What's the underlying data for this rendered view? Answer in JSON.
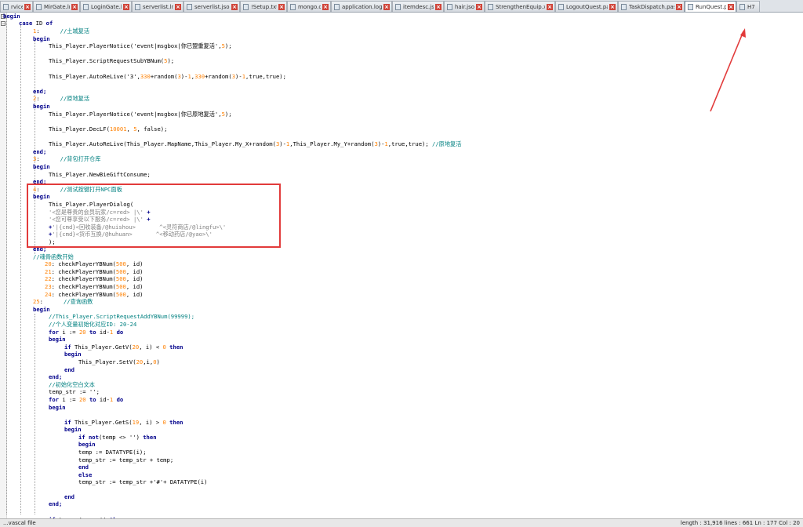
{
  "tabs": [
    {
      "label": "rvice.lni",
      "close": "×",
      "w": 42
    },
    {
      "label": "MirGate.lni",
      "close": "×",
      "w": 60
    },
    {
      "label": "LoginGate.lni",
      "close": "×",
      "w": 66
    },
    {
      "label": "serverlist.lni",
      "close": "×",
      "w": 66
    },
    {
      "label": "serverlist.json",
      "close": "×",
      "w": 72
    },
    {
      "label": "!Setup.txt",
      "close": "×",
      "w": 60
    },
    {
      "label": "mongo.cfg",
      "close": "×",
      "w": 56
    },
    {
      "label": "application.log",
      "close": "×",
      "w": 78
    },
    {
      "label": "itemdesc.json",
      "close": "×",
      "w": 66
    },
    {
      "label": "hair.json",
      "close": "×",
      "w": 52
    },
    {
      "label": "StrengthenEquip.xml",
      "close": "×",
      "w": 90
    },
    {
      "label": "LogoutQuest.pas",
      "close": "×",
      "w": 80
    },
    {
      "label": "TaskDispatch.pas",
      "close": "×",
      "w": 85
    },
    {
      "label": "RunQuest.pas",
      "close": "×",
      "w": 66,
      "active": true
    },
    {
      "label": "H7",
      "close": "",
      "w": 30
    }
  ],
  "code": [
    {
      "t": [
        [
          "begin",
          "kw"
        ]
      ]
    },
    {
      "t": [
        [
          "case ",
          "kw"
        ],
        [
          "ID ",
          ""
        ],
        [
          "of",
          "kw"
        ]
      ]
    },
    {
      "t": [
        [
          "1",
          "ln"
        ],
        [
          ":      ",
          ""
        ],
        [
          "//土城复活",
          "cmt"
        ]
      ]
    },
    {
      "t": [
        [
          "begin",
          "kw"
        ]
      ]
    },
    {
      "t": [
        [
          "This_Player.PlayerNotice(",
          ""
        ],
        [
          "'event|msgbox|你已盟重复活'",
          ""
        ],
        [
          ",",
          ""
        ],
        [
          "5",
          "num"
        ],
        [
          ");",
          ""
        ]
      ]
    },
    {
      "t": []
    },
    {
      "t": [
        [
          "This_Player.ScriptRequestSubYBNum(",
          ""
        ],
        [
          "5",
          "num"
        ],
        [
          ");",
          ""
        ]
      ]
    },
    {
      "t": []
    },
    {
      "t": [
        [
          "This_Player.AutoReLive(",
          ""
        ],
        [
          "'3'",
          ""
        ],
        [
          ",",
          ""
        ],
        [
          "330",
          "num"
        ],
        [
          "+random(",
          ""
        ],
        [
          "3",
          "num"
        ],
        [
          ")-",
          ""
        ],
        [
          "1",
          "num"
        ],
        [
          ",",
          ""
        ],
        [
          "330",
          "num"
        ],
        [
          "+random(",
          ""
        ],
        [
          "3",
          "num"
        ],
        [
          ")-",
          ""
        ],
        [
          "1",
          "num"
        ],
        [
          ",true,true);",
          ""
        ]
      ]
    },
    {
      "t": []
    },
    {
      "t": [
        [
          "end;",
          "kw"
        ]
      ]
    },
    {
      "t": [
        [
          "2",
          "ln"
        ],
        [
          ":      ",
          ""
        ],
        [
          "//原地复活",
          "cmt"
        ]
      ]
    },
    {
      "t": [
        [
          "begin",
          "kw"
        ]
      ]
    },
    {
      "t": [
        [
          "This_Player.PlayerNotice(",
          ""
        ],
        [
          "'event|msgbox|你已原地复活'",
          ""
        ],
        [
          ",",
          ""
        ],
        [
          "5",
          "num"
        ],
        [
          ");",
          ""
        ]
      ]
    },
    {
      "t": []
    },
    {
      "t": [
        [
          "This_Player.DecLF(",
          ""
        ],
        [
          "10001",
          "num"
        ],
        [
          ", ",
          ""
        ],
        [
          "5",
          "num"
        ],
        [
          ", false);",
          ""
        ]
      ]
    },
    {
      "t": []
    },
    {
      "t": [
        [
          "This_Player.AutoReLive(This_Player.MapName,This_Player.My_X+random(",
          ""
        ],
        [
          "3",
          "num"
        ],
        [
          ")-",
          ""
        ],
        [
          "1",
          "num"
        ],
        [
          ",This_Player.My_Y+random(",
          ""
        ],
        [
          "3",
          "num"
        ],
        [
          ")-",
          ""
        ],
        [
          "1",
          "num"
        ],
        [
          ",true,true); ",
          ""
        ],
        [
          "//原地复活",
          "cmt"
        ]
      ]
    },
    {
      "t": [
        [
          "end;",
          "kw"
        ]
      ]
    },
    {
      "t": [
        [
          "3",
          "ln"
        ],
        [
          ":      ",
          ""
        ],
        [
          "//背包打开仓库",
          "cmt"
        ]
      ]
    },
    {
      "t": [
        [
          "begin",
          "kw"
        ]
      ]
    },
    {
      "t": [
        [
          "This_Player.NewBieGiftConsume;",
          ""
        ]
      ]
    },
    {
      "t": [
        [
          "end;",
          "kw"
        ]
      ]
    },
    {
      "t": [
        [
          "4",
          "ln"
        ],
        [
          ":      ",
          ""
        ],
        [
          "//测试按键打开NPC面板",
          "cmt"
        ]
      ]
    },
    {
      "t": [
        [
          "begin",
          "kw"
        ]
      ]
    },
    {
      "t": [
        [
          "This_Player.PlayerDialog(",
          ""
        ]
      ]
    },
    {
      "t": [
        [
          "'<您是尊贵的会员玩家/c=red> |\\' ",
          "str"
        ],
        [
          "+",
          "kw"
        ]
      ]
    },
    {
      "t": [
        [
          "'<您可尊享受以下服务/c=red> |\\' ",
          "str"
        ],
        [
          "+",
          "kw"
        ]
      ]
    },
    {
      "t": [
        [
          "+",
          "kw"
        ],
        [
          "'|{cmd}<回收装备/@huishou>       ^<灵符商店/@lingfu>\\'",
          "str"
        ]
      ]
    },
    {
      "t": [
        [
          "+",
          "kw"
        ],
        [
          "'|{cmd}<货币互换/@huhuan>       ^<移动药店/@yao>\\'",
          "str"
        ]
      ]
    },
    {
      "t": [
        [
          ");",
          ""
        ]
      ]
    },
    {
      "t": [
        [
          "end;",
          "kw"
        ]
      ]
    },
    {
      "t": [
        [
          "//魂骨函数开始",
          "cmt"
        ]
      ]
    },
    {
      "t": [
        [
          "20",
          "ln"
        ],
        [
          ": checkPlayerYBNum(",
          ""
        ],
        [
          "500",
          "num"
        ],
        [
          ", id)",
          ""
        ]
      ]
    },
    {
      "t": [
        [
          "21",
          "ln"
        ],
        [
          ": checkPlayerYBNum(",
          ""
        ],
        [
          "500",
          "num"
        ],
        [
          ", id)",
          ""
        ]
      ]
    },
    {
      "t": [
        [
          "22",
          "ln"
        ],
        [
          ": checkPlayerYBNum(",
          ""
        ],
        [
          "500",
          "num"
        ],
        [
          ", id)",
          ""
        ]
      ]
    },
    {
      "t": [
        [
          "23",
          "ln"
        ],
        [
          ": checkPlayerYBNum(",
          ""
        ],
        [
          "500",
          "num"
        ],
        [
          ", id)",
          ""
        ]
      ]
    },
    {
      "t": [
        [
          "24",
          "ln"
        ],
        [
          ": checkPlayerYBNum(",
          ""
        ],
        [
          "500",
          "num"
        ],
        [
          ", id)",
          ""
        ]
      ]
    },
    {
      "t": [
        [
          "25",
          "ln"
        ],
        [
          ":      ",
          ""
        ],
        [
          "//查询函数",
          "cmt"
        ]
      ]
    },
    {
      "t": [
        [
          "begin",
          "kw"
        ]
      ]
    },
    {
      "t": [
        [
          "//This_Player.ScriptRequestAddYBNum(99999);",
          "cmt"
        ]
      ]
    },
    {
      "t": [
        [
          "//个人变量初始化对应ID: 20-24",
          "cmt"
        ]
      ]
    },
    {
      "t": [
        [
          "for ",
          "kw"
        ],
        [
          "i := ",
          ""
        ],
        [
          "20",
          "num"
        ],
        [
          " ",
          ""
        ],
        [
          "to ",
          "kw"
        ],
        [
          "id-",
          ""
        ],
        [
          "1",
          "num"
        ],
        [
          " ",
          ""
        ],
        [
          "do",
          "kw"
        ]
      ]
    },
    {
      "t": [
        [
          "begin",
          "kw"
        ]
      ]
    },
    {
      "t": [
        [
          "if ",
          "kw"
        ],
        [
          "This_Player.GetV(",
          ""
        ],
        [
          "20",
          "num"
        ],
        [
          ", i) < ",
          ""
        ],
        [
          "0",
          "num"
        ],
        [
          " ",
          ""
        ],
        [
          "then",
          "kw"
        ]
      ]
    },
    {
      "t": [
        [
          "begin",
          "kw"
        ]
      ]
    },
    {
      "t": [
        [
          "This_Player.SetV(",
          ""
        ],
        [
          "20",
          "num"
        ],
        [
          ",i,",
          ""
        ],
        [
          "0",
          "num"
        ],
        [
          ")",
          ""
        ]
      ]
    },
    {
      "t": [
        [
          "end",
          "kw"
        ]
      ]
    },
    {
      "t": [
        [
          "end;",
          "kw"
        ]
      ]
    },
    {
      "t": [
        [
          "//初始化空白文本",
          "cmt"
        ]
      ]
    },
    {
      "t": [
        [
          "temp_str := '';",
          ""
        ]
      ]
    },
    {
      "t": [
        [
          "for ",
          "kw"
        ],
        [
          "i := ",
          ""
        ],
        [
          "20",
          "num"
        ],
        [
          " ",
          ""
        ],
        [
          "to ",
          "kw"
        ],
        [
          "id-",
          ""
        ],
        [
          "1",
          "num"
        ],
        [
          " ",
          ""
        ],
        [
          "do",
          "kw"
        ]
      ]
    },
    {
      "t": [
        [
          "begin",
          "kw"
        ]
      ]
    },
    {
      "t": []
    },
    {
      "t": [
        [
          "if ",
          "kw"
        ],
        [
          "This_Player.GetS(",
          ""
        ],
        [
          "19",
          "num"
        ],
        [
          ", i) > ",
          ""
        ],
        [
          "0",
          "num"
        ],
        [
          " ",
          ""
        ],
        [
          "then",
          "kw"
        ]
      ]
    },
    {
      "t": [
        [
          "begin",
          "kw"
        ]
      ]
    },
    {
      "t": [
        [
          "if not",
          "kw"
        ],
        [
          "(temp <> '') ",
          ""
        ],
        [
          "then",
          "kw"
        ]
      ]
    },
    {
      "t": [
        [
          "begin",
          "kw"
        ]
      ]
    },
    {
      "t": [
        [
          "temp := DATATYPE(i);",
          ""
        ]
      ]
    },
    {
      "t": [
        [
          "temp_str := temp_str + temp;",
          ""
        ]
      ]
    },
    {
      "t": [
        [
          "end",
          "kw"
        ]
      ]
    },
    {
      "t": [
        [
          "else",
          "kw"
        ]
      ]
    },
    {
      "t": [
        [
          "temp_str := temp_str +'#'+ DATATYPE(i)",
          ""
        ]
      ]
    },
    {
      "t": []
    },
    {
      "t": [
        [
          "end",
          "kw"
        ]
      ]
    },
    {
      "t": [
        [
          "end;",
          "kw"
        ]
      ]
    },
    {
      "t": []
    },
    {
      "t": [
        [
          "if ",
          "kw"
        ],
        [
          "temp_str <> '' ",
          ""
        ],
        [
          "then",
          "kw"
        ]
      ]
    }
  ],
  "status": {
    "left": "...vascal file",
    "right": "length : 31,916    lines : 661    Ln : 177    Col : 20"
  },
  "colors": {
    "highlight": "#e23b3b",
    "keyword": "#00008b",
    "number": "#ff8000",
    "comment": "#008080"
  }
}
